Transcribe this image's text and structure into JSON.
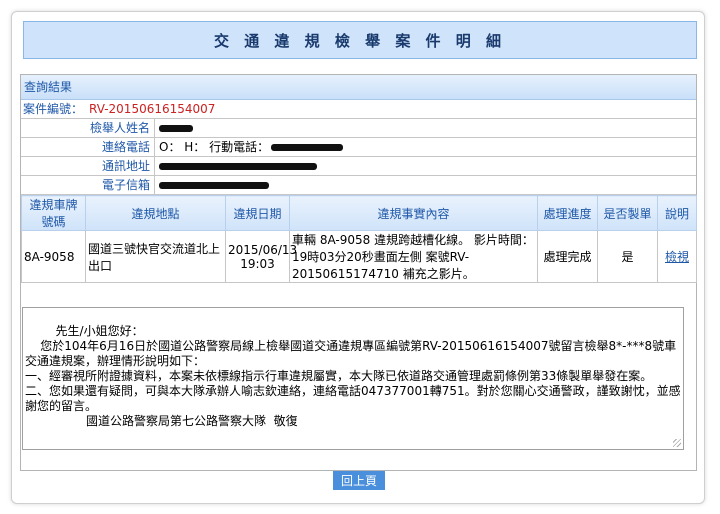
{
  "page": {
    "title": "交 通 違 規 檢 舉 案 件 明 細"
  },
  "result": {
    "section_title": "查詢結果",
    "case_label": "案件編號：",
    "case_number": "RV-20150616154007",
    "fields": [
      {
        "label": "檢舉人姓名",
        "value": ""
      },
      {
        "label": "連絡電話",
        "value": "O：  H：  行動電話："
      },
      {
        "label": "通訊地址",
        "value": ""
      },
      {
        "label": "電子信箱",
        "value": ""
      }
    ]
  },
  "table": {
    "headers": [
      "違規車牌號碼",
      "違規地點",
      "違規日期",
      "違規事實內容",
      "處理進度",
      "是否製單",
      "說明"
    ],
    "rows": [
      {
        "plate": "8A-9058",
        "location": "國道三號快官交流道北上出口",
        "date": "2015/06/13 19:03",
        "content": "車輛 8A-9058 違規跨越槽化線。 影片時間：19時03分20秒畫面左側 案號RV-20150615174710 補充之影片。",
        "progress": "處理完成",
        "ticketed": "是",
        "detail_link": "檢視"
      }
    ]
  },
  "reply": {
    "text": "    先生/小姐您好：\n    您於104年6月16日於國道公路警察局線上檢舉國道交通違規專區編號第RV-20150616154007號留言檢舉8*-***8號車交通違規案，辦理情形說明如下：\n一、經審視所附證據資料，本案未依標線指示行車違規屬實，本大隊已依道路交通管理處罰條例第33條製單舉發在案。\n二、您如果還有疑問，可與本大隊承辦人喻志欽連絡，連絡電話047377001轉751。對於您關心交通警政，謹致謝忱，並感謝您的留言。\n                國道公路警察局第七公路警察大隊  敬復"
  },
  "buttons": {
    "back": "回上頁"
  }
}
